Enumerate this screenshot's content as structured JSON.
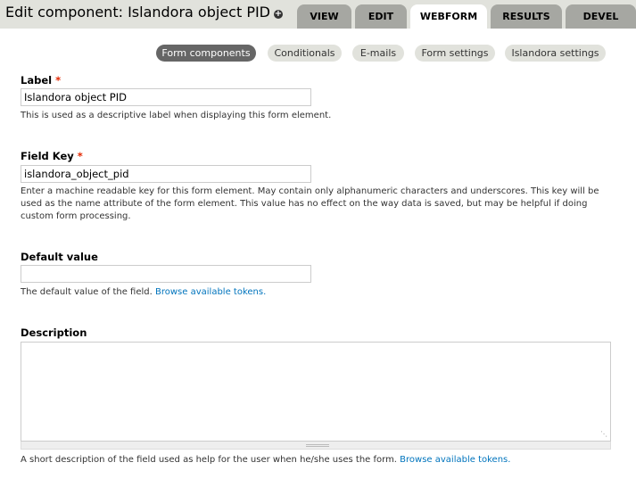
{
  "header": {
    "title": "Edit component: Islandora object PID",
    "shortcut_icon": "plus-circle-icon",
    "tabs": [
      {
        "label": "VIEW",
        "active": false
      },
      {
        "label": "EDIT",
        "active": false
      },
      {
        "label": "WEBFORM",
        "active": true
      },
      {
        "label": "RESULTS",
        "active": false
      },
      {
        "label": "DEVEL",
        "active": false
      }
    ]
  },
  "subtabs": [
    {
      "label": "Form components",
      "active": true
    },
    {
      "label": "Conditionals",
      "active": false
    },
    {
      "label": "E-mails",
      "active": false
    },
    {
      "label": "Form settings",
      "active": false
    },
    {
      "label": "Islandora settings",
      "active": false
    }
  ],
  "form": {
    "label_field": {
      "label": "Label",
      "required_mark": "*",
      "value": "Islandora object PID",
      "description": "This is used as a descriptive label when displaying this form element."
    },
    "field_key": {
      "label": "Field Key",
      "required_mark": "*",
      "value": "islandora_object_pid",
      "description": "Enter a machine readable key for this form element. May contain only alphanumeric characters and underscores. This key will be used as the name attribute of the form element. This value has no effect on the way data is saved, but may be helpful if doing custom form processing."
    },
    "default_value": {
      "label": "Default value",
      "value": "",
      "description": "The default value of the field.",
      "link": "Browse available tokens."
    },
    "description_field": {
      "label": "Description",
      "value": "",
      "description": "A short description of the field used as help for the user when he/she uses the form.",
      "link": "Browse available tokens."
    }
  },
  "colors": {
    "header_bg": "#e1e2dc",
    "tab_bg": "#a6a7a2",
    "active_subtab_bg": "#666666",
    "link": "#0074bd",
    "required": "#e32700"
  }
}
